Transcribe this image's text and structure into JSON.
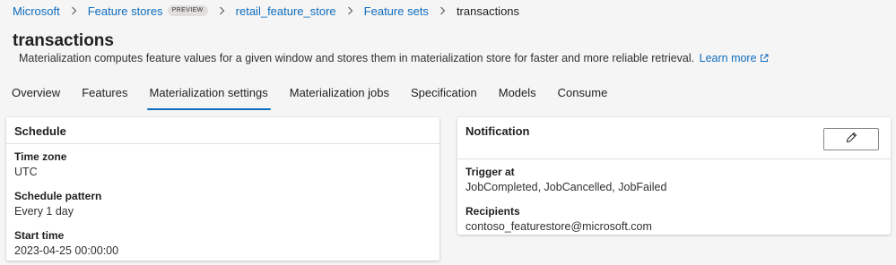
{
  "breadcrumb": {
    "items": [
      "Microsoft",
      "Feature stores",
      "retail_feature_store",
      "Feature sets"
    ],
    "preview_badge": "PREVIEW",
    "current": "transactions"
  },
  "page": {
    "title": "transactions",
    "description": "Materialization computes feature values for a given window and stores them in materialization store for faster and more reliable retrieval.",
    "learn_more": "Learn more"
  },
  "tabs": [
    {
      "label": "Overview",
      "active": false
    },
    {
      "label": "Features",
      "active": false
    },
    {
      "label": "Materialization settings",
      "active": true
    },
    {
      "label": "Materialization jobs",
      "active": false
    },
    {
      "label": "Specification",
      "active": false
    },
    {
      "label": "Models",
      "active": false
    },
    {
      "label": "Consume",
      "active": false
    }
  ],
  "schedule": {
    "title": "Schedule",
    "fields": [
      {
        "label": "Time zone",
        "value": "UTC"
      },
      {
        "label": "Schedule pattern",
        "value": "Every 1 day"
      },
      {
        "label": "Start time",
        "value": "2023-04-25 00:00:00"
      }
    ]
  },
  "notification": {
    "title": "Notification",
    "edit_icon": "pencil-icon",
    "fields": [
      {
        "label": "Trigger at",
        "value": "JobCompleted, JobCancelled, JobFailed"
      },
      {
        "label": "Recipients",
        "value": "contoso_featurestore@microsoft.com"
      }
    ]
  },
  "colors": {
    "accent": "#0f6cbd",
    "background": "#f5f5f5",
    "card": "#ffffff"
  }
}
